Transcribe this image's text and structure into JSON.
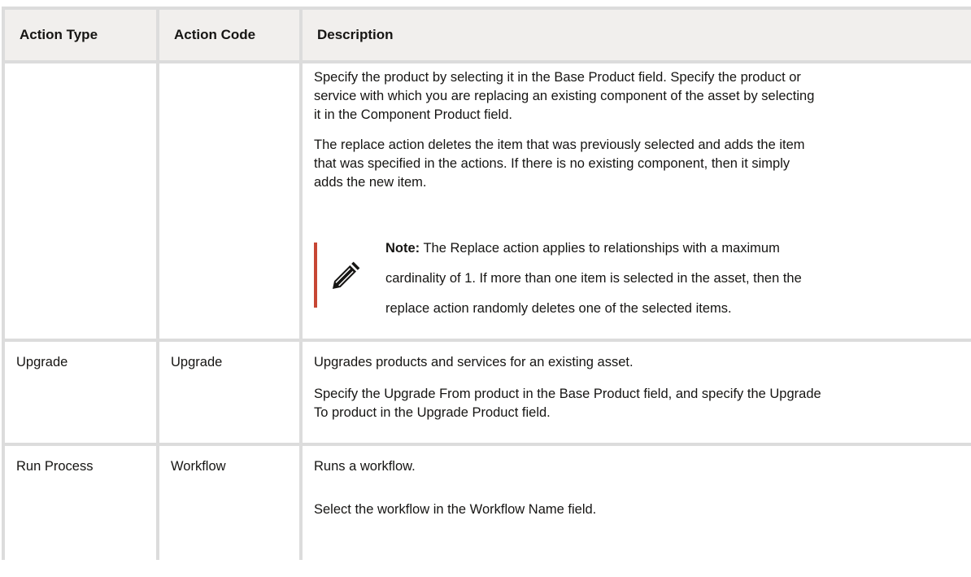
{
  "table": {
    "headers": [
      "Action Type",
      "Action Code",
      "Description"
    ],
    "replace_row": {
      "action_type": "",
      "action_code": "",
      "desc_p1": [
        "Specify the product by selecting it in the Base Product field. Specify the product or",
        "service with which you are replacing an existing component of the asset by selecting",
        "it in the Component Product field."
      ],
      "desc_p2": [
        "The replace action deletes the item that was previously selected and adds the item",
        "that was specified in the actions. If there is no existing component, then it simply",
        "adds the new item."
      ],
      "note_label": "Note:",
      "note_lines": [
        " The Replace action applies to relationships with a maximum",
        "cardinality of 1. If more than one item is selected in the asset, then the",
        "replace action randomly deletes one of the selected items."
      ],
      "note_icon": "pencil-icon",
      "note_accent": "#c74634"
    },
    "upgrade_row": {
      "action_type": "Upgrade",
      "action_code": "Upgrade",
      "desc_p1": "Upgrades products and services for an existing asset.",
      "desc_p2": [
        "Specify the Upgrade From product in the Base Product field, and specify the Upgrade",
        "To product in the Upgrade Product field."
      ]
    },
    "run_process_row": {
      "action_type": "Run Process",
      "action_code": "Workflow",
      "desc_p1": "Runs a workflow.",
      "desc_p2": "Select the workflow in the Workflow Name field."
    }
  }
}
